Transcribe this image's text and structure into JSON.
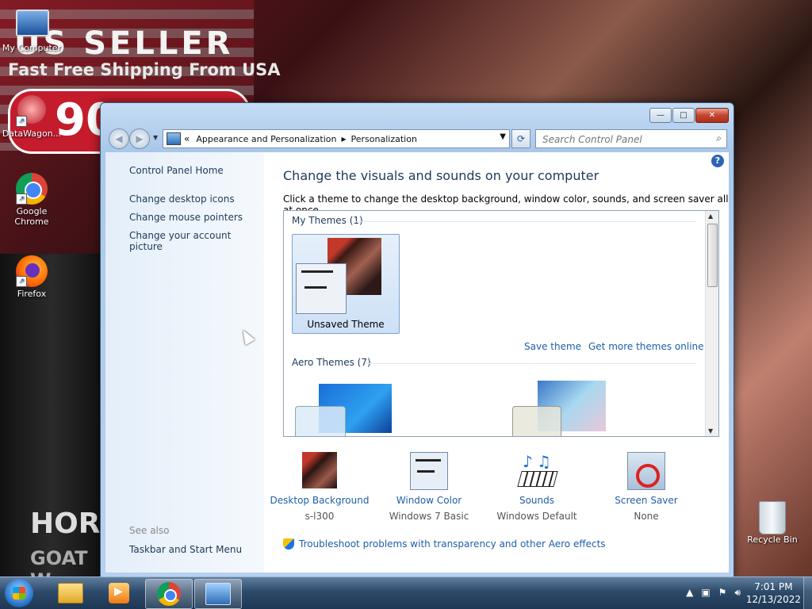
{
  "desktop": {
    "wallpaper_text1": "US SELLER",
    "wallpaper_text2": "Fast Free Shipping From USA",
    "wallpaper_badge": "90",
    "wallpaper_product": "HOR",
    "wallpaper_product2": "GOAT W",
    "icons": [
      {
        "label": "My Computer",
        "icon": "computer-icon"
      },
      {
        "label": "DataWagon...",
        "icon": "datawagon-icon"
      },
      {
        "label": "Google Chrome",
        "icon": "chrome-icon"
      },
      {
        "label": "Firefox",
        "icon": "firefox-icon"
      },
      {
        "label": "Recycle Bin",
        "icon": "recycle-bin-icon"
      }
    ]
  },
  "window": {
    "controls": {
      "minimize": "—",
      "maximize": "□",
      "close": "✕"
    },
    "breadcrumb": {
      "prefix": "«",
      "items": [
        "Appearance and Personalization",
        "Personalization"
      ],
      "separator": "▸"
    },
    "search_placeholder": "Search Control Panel"
  },
  "sidebar": {
    "home": "Control Panel Home",
    "links": [
      "Change desktop icons",
      "Change mouse pointers",
      "Change your account picture"
    ],
    "see_also_label": "See also",
    "see_also_links": [
      "Taskbar and Start Menu"
    ]
  },
  "main": {
    "title": "Change the visuals and sounds on your computer",
    "description": "Click a theme to change the desktop background, window color, sounds, and screen saver all at once.",
    "my_themes_label": "My Themes (1)",
    "my_theme_name": "Unsaved Theme",
    "save_theme": "Save theme",
    "get_more": "Get more themes online",
    "aero_themes_label": "Aero Themes (7)",
    "troubleshoot": "Troubleshoot problems with transparency and other Aero effects"
  },
  "settings": [
    {
      "label": "Desktop Background",
      "value": "s-l300",
      "icon": "desktop-background-icon"
    },
    {
      "label": "Window Color",
      "value": "Windows 7 Basic",
      "icon": "window-color-icon"
    },
    {
      "label": "Sounds",
      "value": "Windows Default",
      "icon": "sounds-icon"
    },
    {
      "label": "Screen Saver",
      "value": "None",
      "icon": "screen-saver-icon"
    }
  ],
  "taskbar": {
    "time": "7:01 PM",
    "date": "12/13/2022"
  }
}
